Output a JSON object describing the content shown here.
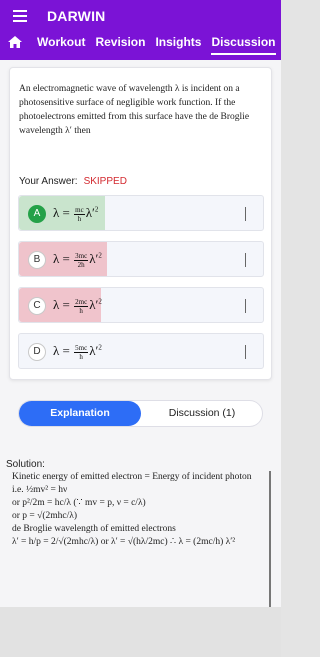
{
  "app": {
    "title": "DARWIN"
  },
  "nav": {
    "tabs": [
      {
        "label": "Workout"
      },
      {
        "label": "Revision"
      },
      {
        "label": "Insights"
      },
      {
        "label": "Discussion"
      }
    ],
    "active_tab": "Discussion"
  },
  "question": {
    "text": "An electromagnetic wave of wavelength λ is incident on a photosensitive surface of negligible work function. If the photoelectrons emitted from this surface have the de Broglie wavelength λ′ then"
  },
  "answer": {
    "label": "Your Answer:",
    "status": "SKIPPED"
  },
  "options": [
    {
      "letter": "A",
      "state": "correct",
      "coef_num": "mc",
      "coef_den": "h"
    },
    {
      "letter": "B",
      "state": "wrong",
      "coef_num": "3mc",
      "coef_den": "2h"
    },
    {
      "letter": "C",
      "state": "wrong",
      "coef_num": "2mc",
      "coef_den": "h"
    },
    {
      "letter": "D",
      "state": "neutral",
      "coef_num": "5mc",
      "coef_den": "h"
    }
  ],
  "segmented": {
    "explanation": "Explanation",
    "discussion": "Discussion (1)"
  },
  "solution": {
    "title": "Solution:",
    "line1": "Kinetic energy of emitted electron = Energy of incident photon",
    "line2": "i.e. ½mv² = hν",
    "line3": "or p²/2m = hc/λ (∵ mv = p, ν = c/λ)",
    "line4": "or p = √(2mhc/λ)",
    "line5": "de Broglie wavelength of emitted electrons",
    "line6": "λ′ = h/p = 2/√(2mhc/λ) or λ′ = √(hλ/2mc) ∴ λ = (2mc/h) λ′²"
  },
  "colors": {
    "brand": "#7b13d6",
    "accent": "#2d6df6",
    "correct": "#24a148",
    "skipped": "#d3292f"
  },
  "icons": [
    "menu-icon",
    "home-icon"
  ]
}
